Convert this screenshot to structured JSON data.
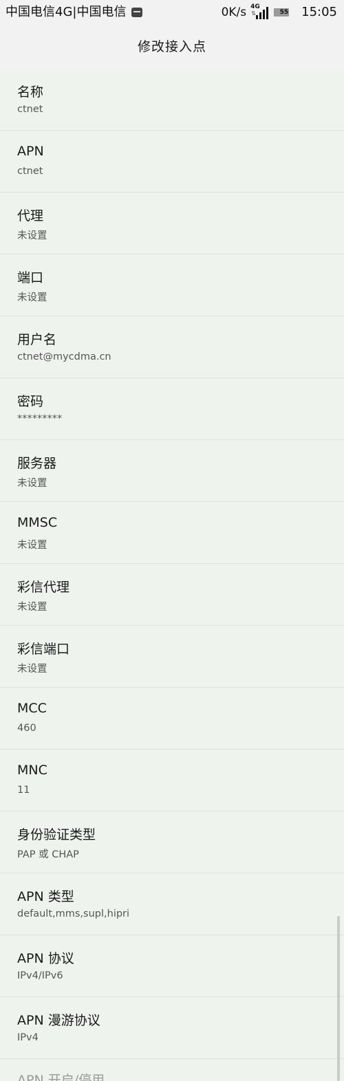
{
  "status_bar": {
    "carrier": "中国电信4G|中国电信",
    "net_speed": "0K/s",
    "network_type": "4G",
    "battery": "55",
    "time": "15:05"
  },
  "header": {
    "title": "修改接入点"
  },
  "apn_settings": [
    {
      "title": "名称",
      "value": "ctnet"
    },
    {
      "title": "APN",
      "value": "ctnet"
    },
    {
      "title": "代理",
      "value": "未设置"
    },
    {
      "title": "端口",
      "value": "未设置"
    },
    {
      "title": "用户名",
      "value": "ctnet@mycdma.cn"
    },
    {
      "title": "密码",
      "value": "*********"
    },
    {
      "title": "服务器",
      "value": "未设置"
    },
    {
      "title": "MMSC",
      "value": "未设置"
    },
    {
      "title": "彩信代理",
      "value": "未设置"
    },
    {
      "title": "彩信端口",
      "value": "未设置"
    },
    {
      "title": "MCC",
      "value": "460"
    },
    {
      "title": "MNC",
      "value": "11"
    },
    {
      "title": "身份验证类型",
      "value": "PAP 或 CHAP"
    },
    {
      "title": "APN 类型",
      "value": "default,mms,supl,hipri"
    },
    {
      "title": "APN 协议",
      "value": "IPv4/IPv6"
    },
    {
      "title": "APN 漫游协议",
      "value": "IPv4"
    },
    {
      "title": "APN 开启/停用",
      "value": ""
    }
  ],
  "colors": {
    "background": "#eff3ee",
    "bars": "#f2f2f2",
    "divider": "#dde2dc"
  }
}
